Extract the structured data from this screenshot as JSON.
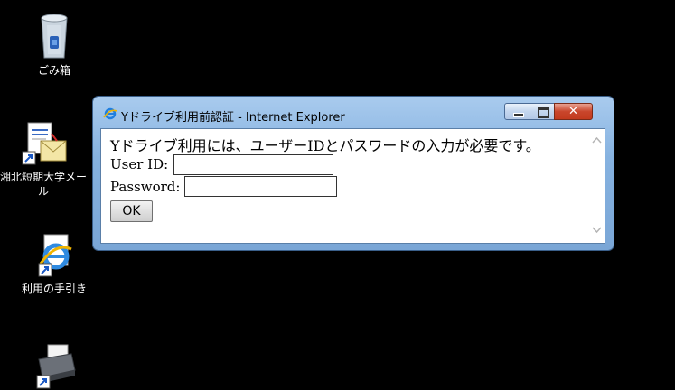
{
  "desktop": {
    "icons": [
      {
        "name": "recycle-bin",
        "label": "ごみ箱"
      },
      {
        "name": "shohoku-mail",
        "label": "湘北短期大学メール"
      },
      {
        "name": "usage-guide",
        "label": "利用の手引き"
      },
      {
        "name": "printer",
        "label": ""
      }
    ]
  },
  "window": {
    "title": "Yドライブ利用前認証 - Internet Explorer",
    "close_symbol": "✕",
    "message": "Yドライブ利用には、ユーザーIDとパスワードの入力が必要です。",
    "userid_label": "User ID:",
    "userid_value": "",
    "password_label": "Password:",
    "password_value": "",
    "ok_label": "OK"
  },
  "colors": {
    "title_bar": "#86b2e0",
    "close_button": "#c9462c"
  }
}
